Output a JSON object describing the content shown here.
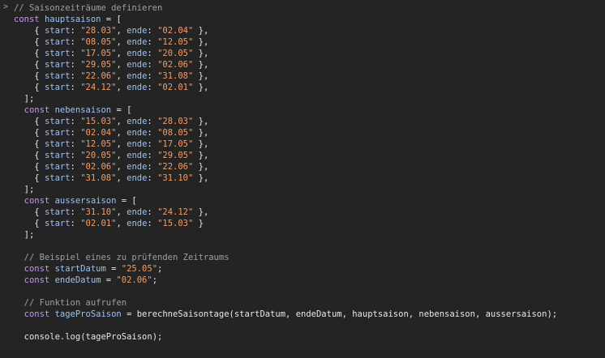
{
  "console": {
    "prompt_glyph": ">",
    "lines": [
      [
        {
          "t": "// Saisonzeiträume definieren",
          "c": "comment"
        }
      ],
      [
        {
          "t": "const ",
          "c": "kw"
        },
        {
          "t": "hauptsaison",
          "c": "var"
        },
        {
          "t": " = [",
          "c": "punct"
        }
      ],
      [
        {
          "t": "    { ",
          "c": "punct"
        },
        {
          "t": "start",
          "c": "prop"
        },
        {
          "t": ": ",
          "c": "punct"
        },
        {
          "t": "\"28.03\"",
          "c": "str"
        },
        {
          "t": ", ",
          "c": "punct"
        },
        {
          "t": "ende",
          "c": "prop"
        },
        {
          "t": ": ",
          "c": "punct"
        },
        {
          "t": "\"02.04\"",
          "c": "str"
        },
        {
          "t": " },",
          "c": "punct"
        }
      ],
      [
        {
          "t": "    { ",
          "c": "punct"
        },
        {
          "t": "start",
          "c": "prop"
        },
        {
          "t": ": ",
          "c": "punct"
        },
        {
          "t": "\"08.05\"",
          "c": "str"
        },
        {
          "t": ", ",
          "c": "punct"
        },
        {
          "t": "ende",
          "c": "prop"
        },
        {
          "t": ": ",
          "c": "punct"
        },
        {
          "t": "\"12.05\"",
          "c": "str"
        },
        {
          "t": " },",
          "c": "punct"
        }
      ],
      [
        {
          "t": "    { ",
          "c": "punct"
        },
        {
          "t": "start",
          "c": "prop"
        },
        {
          "t": ": ",
          "c": "punct"
        },
        {
          "t": "\"17.05\"",
          "c": "str"
        },
        {
          "t": ", ",
          "c": "punct"
        },
        {
          "t": "ende",
          "c": "prop"
        },
        {
          "t": ": ",
          "c": "punct"
        },
        {
          "t": "\"20.05\"",
          "c": "str"
        },
        {
          "t": " },",
          "c": "punct"
        }
      ],
      [
        {
          "t": "    { ",
          "c": "punct"
        },
        {
          "t": "start",
          "c": "prop"
        },
        {
          "t": ": ",
          "c": "punct"
        },
        {
          "t": "\"29.05\"",
          "c": "str"
        },
        {
          "t": ", ",
          "c": "punct"
        },
        {
          "t": "ende",
          "c": "prop"
        },
        {
          "t": ": ",
          "c": "punct"
        },
        {
          "t": "\"02.06\"",
          "c": "str"
        },
        {
          "t": " },",
          "c": "punct"
        }
      ],
      [
        {
          "t": "    { ",
          "c": "punct"
        },
        {
          "t": "start",
          "c": "prop"
        },
        {
          "t": ": ",
          "c": "punct"
        },
        {
          "t": "\"22.06\"",
          "c": "str"
        },
        {
          "t": ", ",
          "c": "punct"
        },
        {
          "t": "ende",
          "c": "prop"
        },
        {
          "t": ": ",
          "c": "punct"
        },
        {
          "t": "\"31.08\"",
          "c": "str"
        },
        {
          "t": " },",
          "c": "punct"
        }
      ],
      [
        {
          "t": "    { ",
          "c": "punct"
        },
        {
          "t": "start",
          "c": "prop"
        },
        {
          "t": ": ",
          "c": "punct"
        },
        {
          "t": "\"24.12\"",
          "c": "str"
        },
        {
          "t": ", ",
          "c": "punct"
        },
        {
          "t": "ende",
          "c": "prop"
        },
        {
          "t": ": ",
          "c": "punct"
        },
        {
          "t": "\"02.01\"",
          "c": "str"
        },
        {
          "t": " },",
          "c": "punct"
        }
      ],
      [
        {
          "t": "  ];",
          "c": "punct"
        }
      ],
      [
        {
          "t": "  const ",
          "c": "kw"
        },
        {
          "t": "nebensaison",
          "c": "var"
        },
        {
          "t": " = [",
          "c": "punct"
        }
      ],
      [
        {
          "t": "    { ",
          "c": "punct"
        },
        {
          "t": "start",
          "c": "prop"
        },
        {
          "t": ": ",
          "c": "punct"
        },
        {
          "t": "\"15.03\"",
          "c": "str"
        },
        {
          "t": ", ",
          "c": "punct"
        },
        {
          "t": "ende",
          "c": "prop"
        },
        {
          "t": ": ",
          "c": "punct"
        },
        {
          "t": "\"28.03\"",
          "c": "str"
        },
        {
          "t": " },",
          "c": "punct"
        }
      ],
      [
        {
          "t": "    { ",
          "c": "punct"
        },
        {
          "t": "start",
          "c": "prop"
        },
        {
          "t": ": ",
          "c": "punct"
        },
        {
          "t": "\"02.04\"",
          "c": "str"
        },
        {
          "t": ", ",
          "c": "punct"
        },
        {
          "t": "ende",
          "c": "prop"
        },
        {
          "t": ": ",
          "c": "punct"
        },
        {
          "t": "\"08.05\"",
          "c": "str"
        },
        {
          "t": " },",
          "c": "punct"
        }
      ],
      [
        {
          "t": "    { ",
          "c": "punct"
        },
        {
          "t": "start",
          "c": "prop"
        },
        {
          "t": ": ",
          "c": "punct"
        },
        {
          "t": "\"12.05\"",
          "c": "str"
        },
        {
          "t": ", ",
          "c": "punct"
        },
        {
          "t": "ende",
          "c": "prop"
        },
        {
          "t": ": ",
          "c": "punct"
        },
        {
          "t": "\"17.05\"",
          "c": "str"
        },
        {
          "t": " },",
          "c": "punct"
        }
      ],
      [
        {
          "t": "    { ",
          "c": "punct"
        },
        {
          "t": "start",
          "c": "prop"
        },
        {
          "t": ": ",
          "c": "punct"
        },
        {
          "t": "\"20.05\"",
          "c": "str"
        },
        {
          "t": ", ",
          "c": "punct"
        },
        {
          "t": "ende",
          "c": "prop"
        },
        {
          "t": ": ",
          "c": "punct"
        },
        {
          "t": "\"29.05\"",
          "c": "str"
        },
        {
          "t": " },",
          "c": "punct"
        }
      ],
      [
        {
          "t": "    { ",
          "c": "punct"
        },
        {
          "t": "start",
          "c": "prop"
        },
        {
          "t": ": ",
          "c": "punct"
        },
        {
          "t": "\"02.06\"",
          "c": "str"
        },
        {
          "t": ", ",
          "c": "punct"
        },
        {
          "t": "ende",
          "c": "prop"
        },
        {
          "t": ": ",
          "c": "punct"
        },
        {
          "t": "\"22.06\"",
          "c": "str"
        },
        {
          "t": " },",
          "c": "punct"
        }
      ],
      [
        {
          "t": "    { ",
          "c": "punct"
        },
        {
          "t": "start",
          "c": "prop"
        },
        {
          "t": ": ",
          "c": "punct"
        },
        {
          "t": "\"31.08\"",
          "c": "str"
        },
        {
          "t": ", ",
          "c": "punct"
        },
        {
          "t": "ende",
          "c": "prop"
        },
        {
          "t": ": ",
          "c": "punct"
        },
        {
          "t": "\"31.10\"",
          "c": "str"
        },
        {
          "t": " },",
          "c": "punct"
        }
      ],
      [
        {
          "t": "  ];",
          "c": "punct"
        }
      ],
      [
        {
          "t": "  const ",
          "c": "kw"
        },
        {
          "t": "aussersaison",
          "c": "var"
        },
        {
          "t": " = [",
          "c": "punct"
        }
      ],
      [
        {
          "t": "    { ",
          "c": "punct"
        },
        {
          "t": "start",
          "c": "prop"
        },
        {
          "t": ": ",
          "c": "punct"
        },
        {
          "t": "\"31.10\"",
          "c": "str"
        },
        {
          "t": ", ",
          "c": "punct"
        },
        {
          "t": "ende",
          "c": "prop"
        },
        {
          "t": ": ",
          "c": "punct"
        },
        {
          "t": "\"24.12\"",
          "c": "str"
        },
        {
          "t": " },",
          "c": "punct"
        }
      ],
      [
        {
          "t": "    { ",
          "c": "punct"
        },
        {
          "t": "start",
          "c": "prop"
        },
        {
          "t": ": ",
          "c": "punct"
        },
        {
          "t": "\"02.01\"",
          "c": "str"
        },
        {
          "t": ", ",
          "c": "punct"
        },
        {
          "t": "ende",
          "c": "prop"
        },
        {
          "t": ": ",
          "c": "punct"
        },
        {
          "t": "\"15.03\"",
          "c": "str"
        },
        {
          "t": " }",
          "c": "punct"
        }
      ],
      [
        {
          "t": "  ];",
          "c": "punct"
        }
      ],
      [
        {
          "t": "",
          "c": "plain"
        }
      ],
      [
        {
          "t": "  ",
          "c": "plain"
        },
        {
          "t": "// Beispiel eines zu prüfenden Zeitraums",
          "c": "comment"
        }
      ],
      [
        {
          "t": "  const ",
          "c": "kw"
        },
        {
          "t": "startDatum",
          "c": "var"
        },
        {
          "t": " = ",
          "c": "punct"
        },
        {
          "t": "\"25.05\"",
          "c": "str"
        },
        {
          "t": ";",
          "c": "punct"
        }
      ],
      [
        {
          "t": "  const ",
          "c": "kw"
        },
        {
          "t": "endeDatum",
          "c": "var"
        },
        {
          "t": " = ",
          "c": "punct"
        },
        {
          "t": "\"02.06\"",
          "c": "str"
        },
        {
          "t": ";",
          "c": "punct"
        }
      ],
      [
        {
          "t": "",
          "c": "plain"
        }
      ],
      [
        {
          "t": "  ",
          "c": "plain"
        },
        {
          "t": "// Funktion aufrufen",
          "c": "comment"
        }
      ],
      [
        {
          "t": "  const ",
          "c": "kw"
        },
        {
          "t": "tageProSaison",
          "c": "var"
        },
        {
          "t": " = berechneSaisontage(startDatum, endeDatum, hauptsaison, nebensaison, aussersaison);",
          "c": "plain"
        }
      ],
      [
        {
          "t": "",
          "c": "plain"
        }
      ],
      [
        {
          "t": "  console.",
          "c": "plain"
        },
        {
          "t": "log",
          "c": "fn"
        },
        {
          "t": "(tageProSaison);",
          "c": "plain"
        }
      ]
    ]
  },
  "colors": {
    "background": "#242424",
    "comment": "#9aa0a6",
    "keyword": "#c695f6",
    "identifier": "#9cc2f5",
    "string": "#f59d65",
    "plain": "#e8e8e8"
  }
}
